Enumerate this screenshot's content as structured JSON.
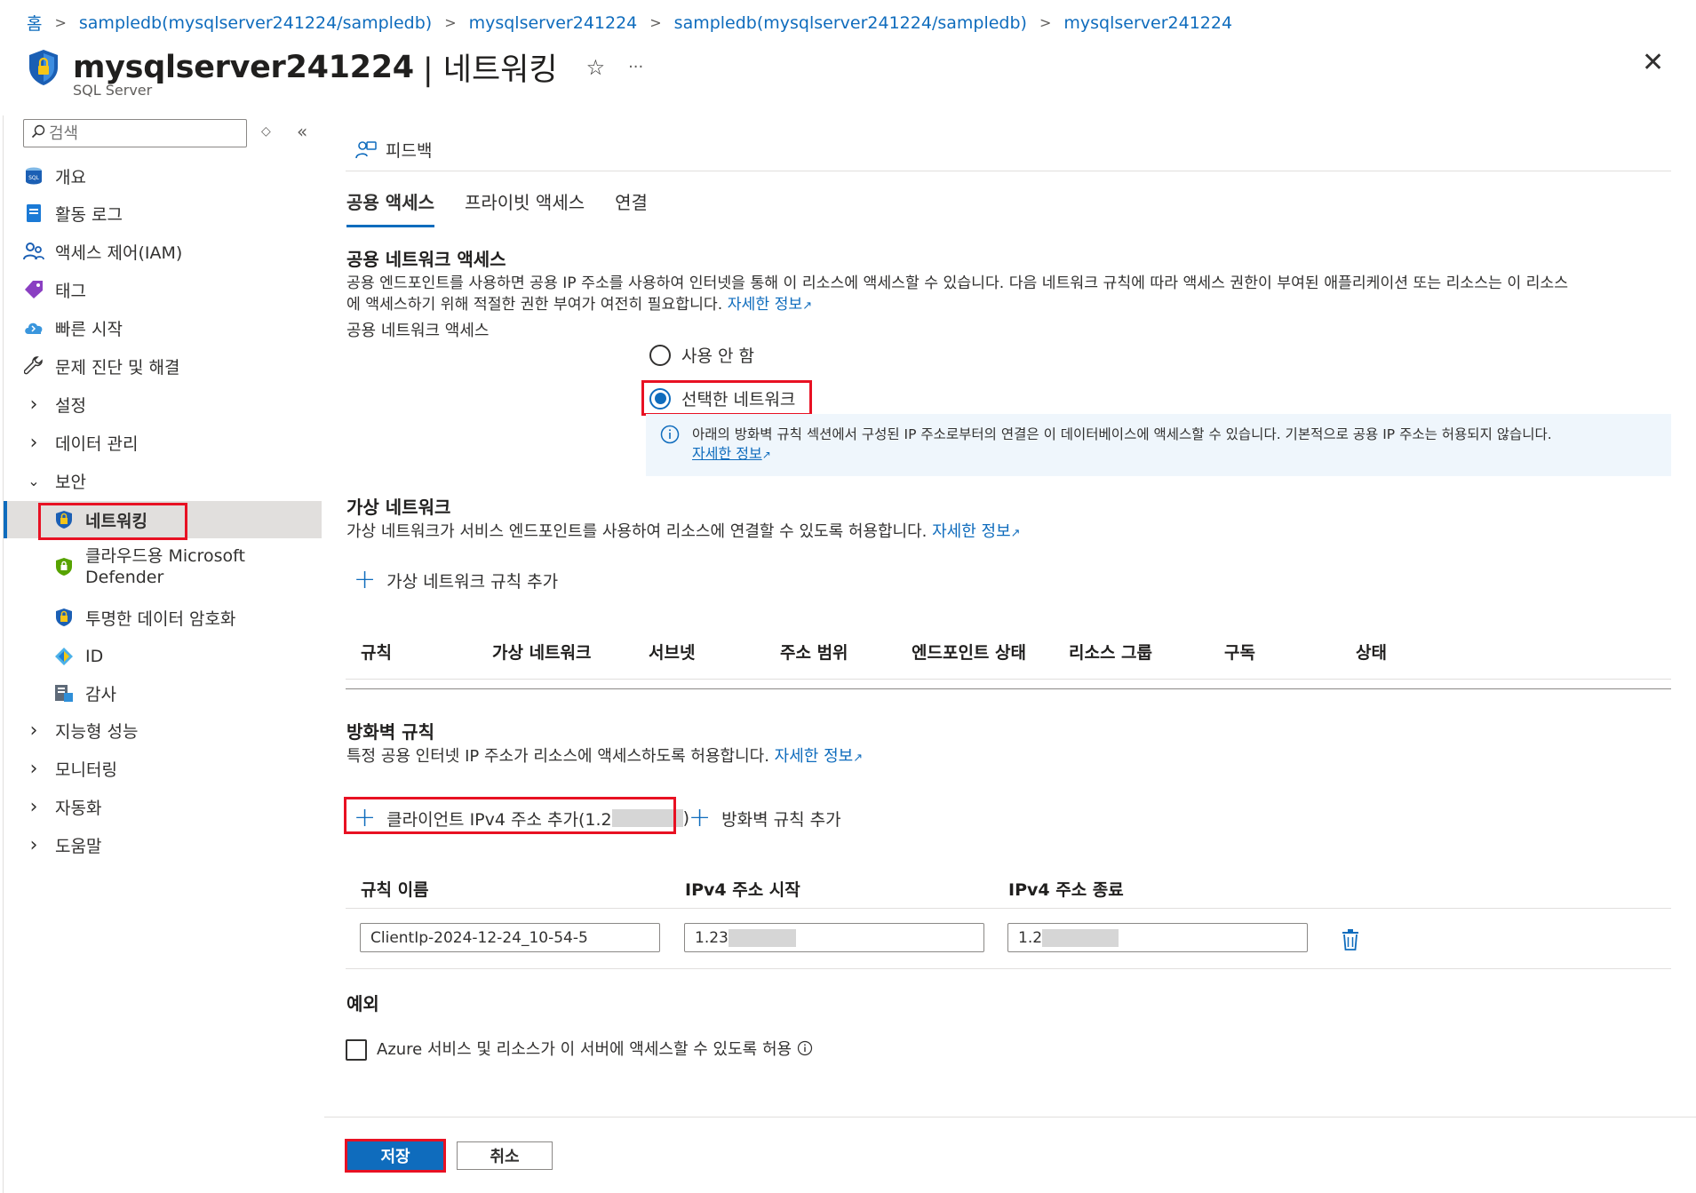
{
  "breadcrumb": {
    "items": [
      "홈",
      "sampledb(mysqlserver241224/sampledb)",
      "mysqlserver241224",
      "sampledb(mysqlserver241224/sampledb)",
      "mysqlserver241224"
    ]
  },
  "header": {
    "title": "mysqlserver241224",
    "title_suffix": "| 네트워킹",
    "subtitle": "SQL Server",
    "star": "☆",
    "more": "···",
    "close": "✕"
  },
  "sidebar": {
    "search_placeholder": "검색",
    "items": [
      {
        "label": "개요",
        "icon": "sql-icon"
      },
      {
        "label": "활동 로그",
        "icon": "activity-log-icon"
      },
      {
        "label": "액세스 제어(IAM)",
        "icon": "people-icon"
      },
      {
        "label": "태그",
        "icon": "tag-icon"
      },
      {
        "label": "빠른 시작",
        "icon": "cloud-icon"
      },
      {
        "label": "문제 진단 및 해결",
        "icon": "wrench-icon"
      },
      {
        "label": "설정",
        "icon": "chevron-right-icon"
      },
      {
        "label": "데이터 관리",
        "icon": "chevron-right-icon"
      },
      {
        "label": "보안",
        "icon": "chevron-down-icon"
      },
      {
        "label": "네트워킹",
        "icon": "shield-icon"
      },
      {
        "label": "클라우드용 Microsoft",
        "label2": "Defender",
        "icon": "defender-shield-icon"
      },
      {
        "label": "투명한 데이터 암호화",
        "icon": "shield-icon"
      },
      {
        "label": "ID",
        "icon": "identity-icon"
      },
      {
        "label": "감사",
        "icon": "audit-icon"
      },
      {
        "label": "지능형 성능",
        "icon": "chevron-right-icon"
      },
      {
        "label": "모니터링",
        "icon": "chevron-right-icon"
      },
      {
        "label": "자동화",
        "icon": "chevron-right-icon"
      },
      {
        "label": "도움말",
        "icon": "chevron-right-icon"
      }
    ]
  },
  "toolbar": {
    "feedback": "피드백"
  },
  "tabs": [
    "공용 액세스",
    "프라이빗 액세스",
    "연결"
  ],
  "public_access": {
    "title": "공용 네트워크 액세스",
    "description_line1": "공용 엔드포인트를 사용하면 공용 IP 주소를 사용하여 인터넷을 통해 이 리소스에 액세스할 수 있습니다. 다음 네트워크 규칙에 따라 액세스 권한이 부여된 애플리케이션 또는 리소스는 이 리소스",
    "description_line2": "에 액세스하기 위해 적절한 권한 부여가 여전히 필요합니다.",
    "learn_more": "자세한 정보",
    "field_label": "공용 네트워크 액세스",
    "options": [
      "사용 안 함",
      "선택한 네트워크"
    ],
    "selected": "선택한 네트워크",
    "info_text": "아래의 방화벽 규칙 섹션에서 구성된 IP 주소로부터의 연결은 이 데이터베이스에 액세스할 수 있습니다. 기본적으로 공용 IP 주소는 허용되지 않습니다.",
    "info_link": "자세한 정보"
  },
  "virtual_network": {
    "title": "가상 네트워크",
    "description": "가상 네트워크가 서비스 엔드포인트를 사용하여 리소스에 연결할 수 있도록 허용합니다.",
    "learn_more": "자세한 정보",
    "add_rule": "가상 네트워크 규칙 추가",
    "columns": [
      "규칙",
      "가상 네트워크",
      "서브넷",
      "주소 범위",
      "엔드포인트 상태",
      "리소스 그룹",
      "구독",
      "상태"
    ]
  },
  "firewall": {
    "title": "방화벽 규칙",
    "description": "특정 공용 인터넷 IP 주소가 리소스에 액세스하도록 허용합니다.",
    "learn_more": "자세한 정보",
    "add_client": "클라이언트 IPv4 주소 추가(1.2",
    "add_client_end": ")",
    "add_rule": "방화벽 규칙 추가",
    "columns": [
      "규칙 이름",
      "IPv4 주소 시작",
      "IPv4 주소 종료"
    ],
    "rows": [
      {
        "name": "ClientIp-2024-12-24_10-54-5",
        "start": "1.23",
        "end": "1.2"
      }
    ]
  },
  "exceptions": {
    "title": "예외",
    "allow_azure": "Azure 서비스 및 리소스가 이 서버에 액세스할 수 있도록 허용",
    "allow_azure_checked": false
  },
  "footer": {
    "save": "저장",
    "cancel": "취소"
  },
  "colors": {
    "accent": "#0f6cbd",
    "highlight": "#e81123",
    "selected_bg": "#e1dfdd"
  }
}
